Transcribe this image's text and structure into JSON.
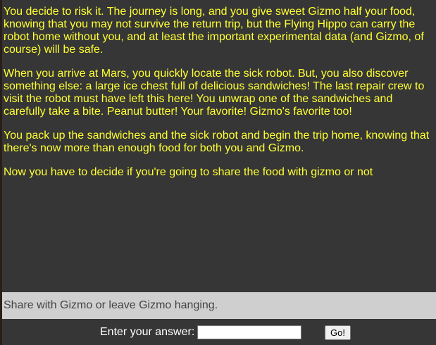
{
  "story": {
    "paragraphs": [
      "You decide to risk it. The journey is long, and you give sweet Gizmo half your food, knowing that you may not survive the return trip, but the Flying Hippo can carry the robot home without you, and at least the important experimental data (and Gizmo, of course) will be safe.",
      "When you arrive at Mars, you quickly locate the sick robot. But, you also discover something else: a large ice chest full of delicious sandwiches! The last repair crew to visit the robot must have left this here! You unwrap one of the sandwiches and carefully take a bite. Peanut butter! Your favorite! Gizmo's favorite too!",
      "You pack up the sandwiches and the sick robot and begin the trip home, knowing that there's now more than enough food for both you and Gizmo.",
      "Now you have to decide if you're going to share the food with gizmo or not"
    ]
  },
  "prompt": {
    "text": "Share with Gizmo or leave Gizmo hanging."
  },
  "answer": {
    "label": "Enter your answer:",
    "value": "",
    "button_label": "Go!"
  },
  "colors": {
    "story_text": "#ffff33",
    "background": "#363636",
    "prompt_bar": "#cfcfcf"
  }
}
